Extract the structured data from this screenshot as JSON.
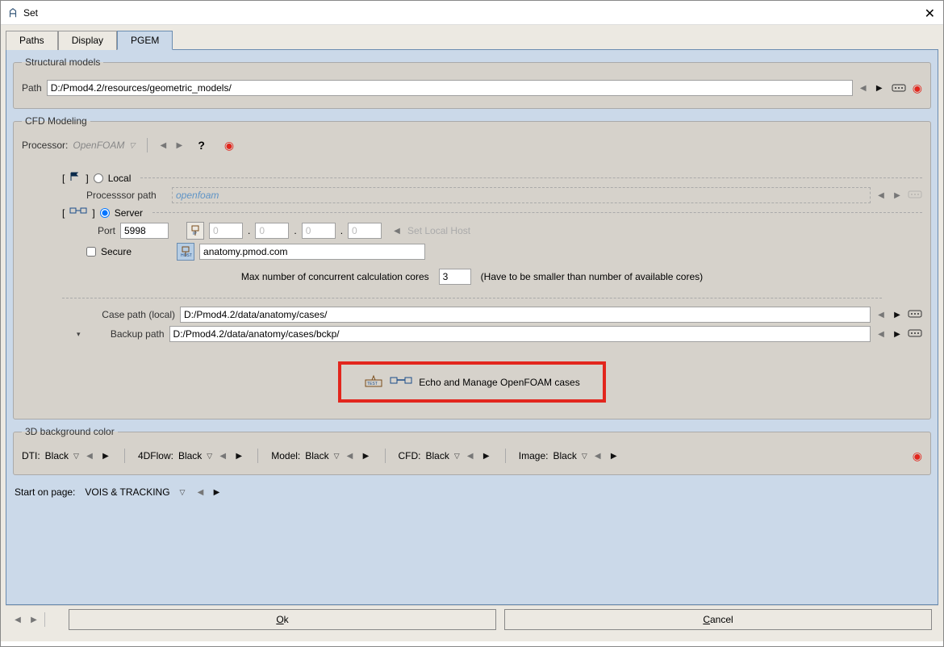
{
  "window": {
    "title": "Set"
  },
  "tabs": [
    "Paths",
    "Display",
    "PGEM"
  ],
  "structural": {
    "legend": "Structural models",
    "path_label": "Path",
    "path_value": "D:/Pmod4.2/resources/geometric_models/"
  },
  "cfd": {
    "legend": "CFD Modeling",
    "processor_label": "Processor:",
    "processor_value": "OpenFOAM",
    "local_label": "Local",
    "processor_path_label": "Processsor path",
    "processor_path_value": "openfoam",
    "server_label": "Server",
    "port_label": "Port",
    "port_value": "5998",
    "ip": [
      "0",
      "0",
      "0",
      "0"
    ],
    "set_local_host": "Set Local Host",
    "secure_label": "Secure",
    "host_value": "anatomy.pmod.com",
    "max_cores_label": "Max number of concurrent calculation cores",
    "max_cores_value": "3",
    "max_cores_hint": "(Have to be smaller than number of available cores)",
    "case_path_label": "Case path (local)",
    "case_path_value": "D:/Pmod4.2/data/anatomy/cases/",
    "backup_path_label": "Backup path",
    "backup_path_value": "D:/Pmod4.2/data/anatomy/cases/bckp/",
    "echo_label": "Echo and Manage OpenFOAM cases"
  },
  "bg": {
    "legend": "3D background color",
    "items": [
      {
        "label": "DTI:",
        "value": "Black"
      },
      {
        "label": "4DFlow:",
        "value": "Black"
      },
      {
        "label": "Model:",
        "value": "Black"
      },
      {
        "label": "CFD:",
        "value": "Black"
      },
      {
        "label": "Image:",
        "value": "Black"
      }
    ]
  },
  "start": {
    "label": "Start on page:",
    "value": "VOIS & TRACKING"
  },
  "buttons": {
    "ok": "Ok",
    "cancel": "Cancel"
  }
}
